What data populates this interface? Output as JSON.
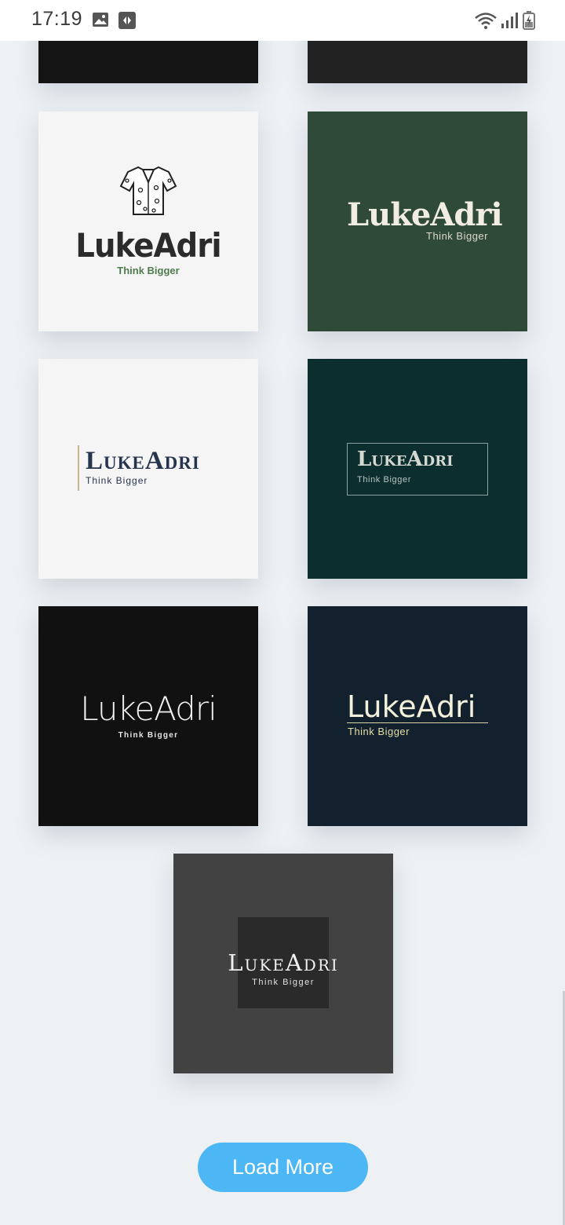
{
  "status_bar": {
    "time": "17:19",
    "left_icons": [
      "image-icon",
      "app-notification-icon"
    ],
    "right_icons": [
      "wifi-icon",
      "signal-icon",
      "battery-charging-icon"
    ]
  },
  "logos": [
    {
      "brand": "LukeAdri",
      "tagline": "Think Bigger",
      "background": "#f5f5f5",
      "icon": "shirt-icon"
    },
    {
      "brand": "LukeAdri",
      "tagline": "Think Bigger",
      "background": "#2f4a39"
    },
    {
      "brand": "LukeAdri",
      "tagline": "Think Bigger",
      "background": "#f5f5f5"
    },
    {
      "brand": "LukeAdri",
      "tagline": "Think Bigger",
      "background": "#0c2e2e"
    },
    {
      "brand": "LukeAdri",
      "tagline": "Think Bigger",
      "background": "#111111"
    },
    {
      "brand": "LukeAdri",
      "tagline": "Think Bigger",
      "background": "#12212d"
    },
    {
      "brand": "LukeAdri",
      "tagline": "Think Bigger",
      "background": "#424242"
    }
  ],
  "load_more_label": "Load More"
}
